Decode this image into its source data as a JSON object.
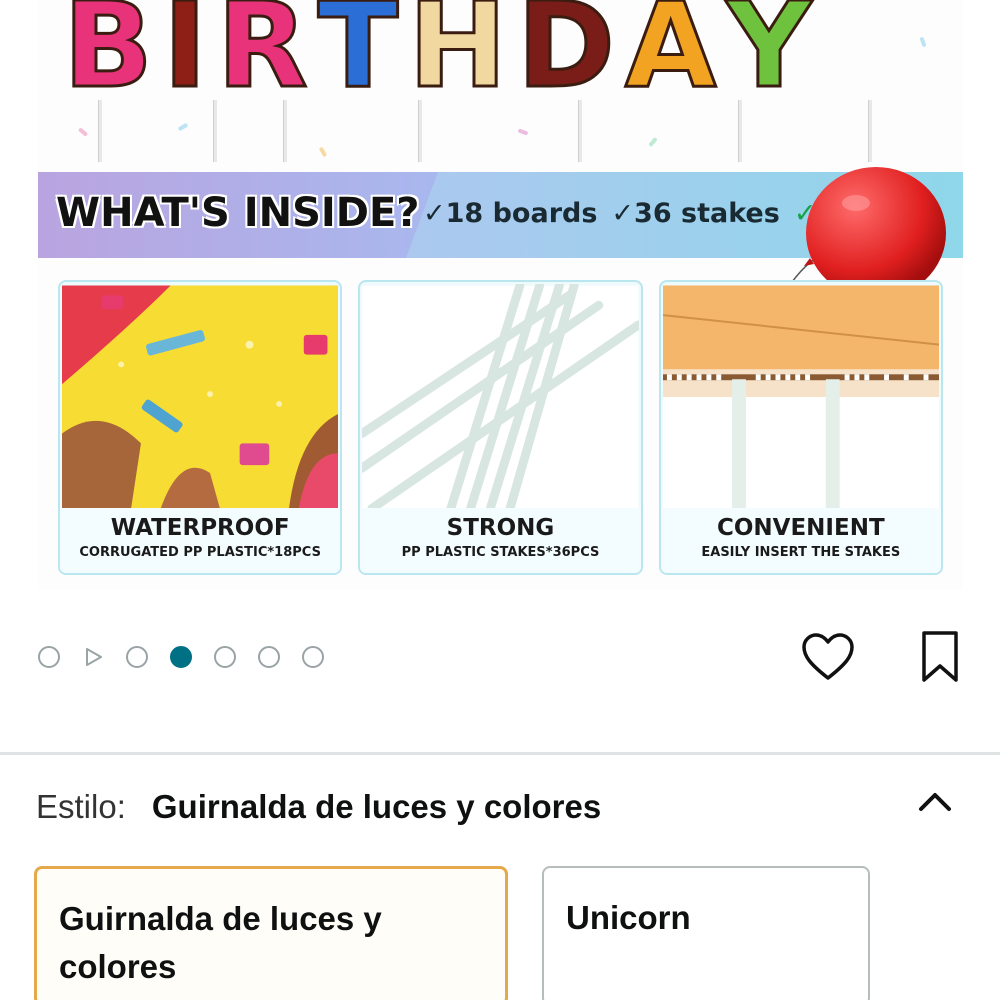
{
  "product_image": {
    "banner_letters": [
      "B",
      "I",
      "R",
      "T",
      "H",
      "D",
      "A",
      "Y"
    ],
    "whats_inside_title": "WHAT'S INSIDE?",
    "inside_items": [
      "✓18 boards",
      "✓36 stakes",
      "✓"
    ],
    "cards": [
      {
        "title": "WATERPROOF",
        "subtitle": "CORRUGATED PP PLASTIC*18PCS"
      },
      {
        "title": "STRONG",
        "subtitle": "PP PLASTIC STAKES*36PCS"
      },
      {
        "title": "CONVENIENT",
        "subtitle": "EASILY INSERT THE STAKES"
      }
    ]
  },
  "carousel": {
    "active_index": 3,
    "total_dots": 7,
    "play_icon": "play-icon",
    "favorite_icon": "heart-icon",
    "save_icon": "bookmark-icon"
  },
  "style_selector": {
    "label": "Estilo:",
    "selected_value": "Guirnalda de luces y colores",
    "options": [
      {
        "label": "Guirnalda de luces y colores",
        "selected": true
      },
      {
        "label": "Unicorn",
        "selected": false
      }
    ],
    "collapse_icon": "chevron-up-icon"
  },
  "colors": {
    "accent_teal": "#007185",
    "selected_border": "#e5a94c",
    "check_green": "#15a34a"
  }
}
